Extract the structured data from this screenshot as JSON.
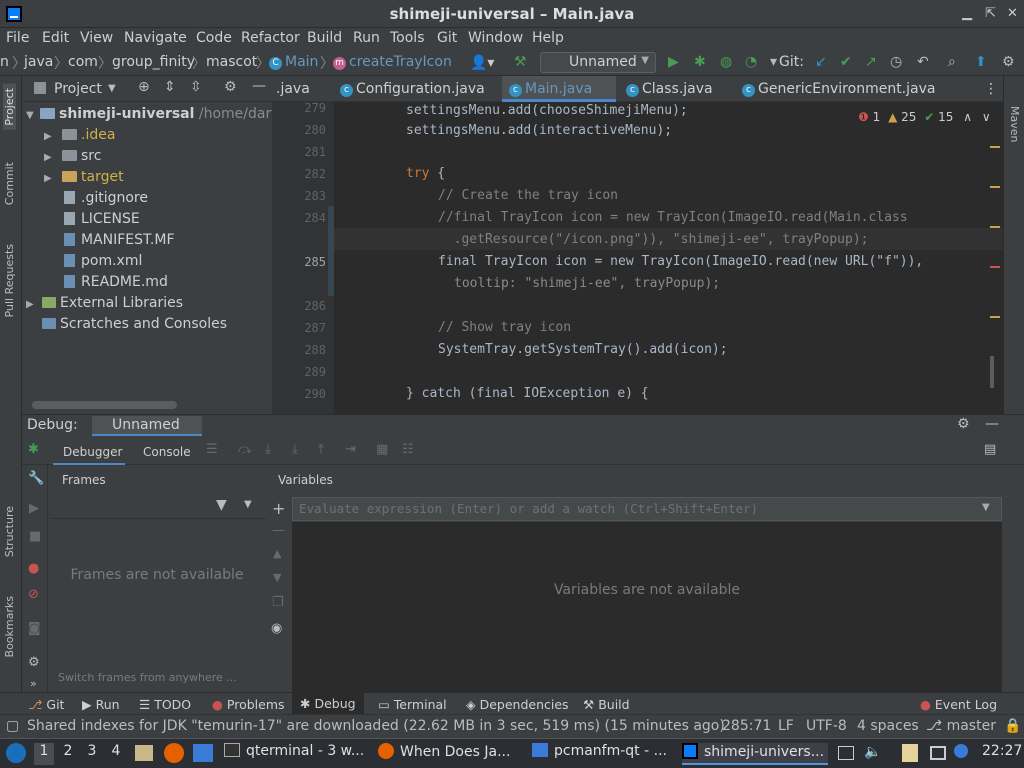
{
  "window": {
    "title": "shimeji-universal – Main.java"
  },
  "menu": [
    "File",
    "Edit",
    "View",
    "Navigate",
    "Code",
    "Refactor",
    "Build",
    "Run",
    "Tools",
    "Git",
    "Window",
    "Help"
  ],
  "nav": {
    "crumbs": [
      "n",
      "java",
      "com",
      "group_finity",
      "mascot",
      "Main",
      "createTrayIcon"
    ],
    "run_config": "Unnamed",
    "git_label": "Git:"
  },
  "project": {
    "title": "Project",
    "root": "shimeji-universal",
    "root_path": "/home/dartz",
    "items": [
      ".idea",
      "src",
      "target",
      ".gitignore",
      "LICENSE",
      "MANIFEST.MF",
      "pom.xml",
      "README.md",
      "External Libraries",
      "Scratches and Consoles"
    ]
  },
  "tabs": [
    ".java",
    "Configuration.java",
    "Main.java",
    "Class.java",
    "GenericEnvironment.java"
  ],
  "inspections": {
    "errors": "1",
    "warnings": "25",
    "ok": "15"
  },
  "code": {
    "lines": [
      {
        "n": "279",
        "text": "settingsMenu.add(chooseShimejiMenu);"
      },
      {
        "n": "280",
        "text": "settingsMenu.add(interactiveMenu);"
      },
      {
        "n": "281",
        "text": ""
      },
      {
        "n": "282",
        "kw": "try",
        "text": " {"
      },
      {
        "n": "283",
        "comment": "// Create the tray icon"
      },
      {
        "n": "284",
        "comment": "//final TrayIcon icon = new TrayIcon(ImageIO.read(Main.class"
      },
      {
        "n": "",
        "comment": "  .getResource(\"/icon.png\")), \"shimeji-ee\", trayPopup);"
      },
      {
        "n": "285",
        "text": "final TrayIcon icon = new TrayIcon(ImageIO.read(new URL(\"f\")),"
      },
      {
        "n": "",
        "text": "tooltip: \"shimeji-ee\", trayPopup);"
      },
      {
        "n": "286",
        "text": ""
      },
      {
        "n": "287",
        "comment": "// Show tray icon"
      },
      {
        "n": "288",
        "text": "SystemTray.getSystemTray().add(icon);"
      },
      {
        "n": "289",
        "text": ""
      },
      {
        "n": "290",
        "text": "} catch (final IOException e) {"
      }
    ]
  },
  "debug": {
    "label": "Debug:",
    "config": "Unnamed",
    "tab_debugger": "Debugger",
    "tab_console": "Console",
    "frames_title": "Frames",
    "frames_empty": "Frames are not available",
    "frames_hint": "Switch frames from anywhere ...",
    "vars_title": "Variables",
    "eval_placeholder": "Evaluate expression (Enter) or add a watch (Ctrl+Shift+Enter)",
    "vars_empty": "Variables are not available"
  },
  "side": {
    "left_top": [
      "Project",
      "Commit",
      "Pull Requests"
    ],
    "left_bottom": [
      "Structure",
      "Bookmarks"
    ],
    "right": [
      "Maven"
    ]
  },
  "tooltabs": [
    "Git",
    "Run",
    "TODO",
    "Problems",
    "Debug",
    "Terminal",
    "Dependencies",
    "Build",
    "Event Log"
  ],
  "status": {
    "message": "Shared indexes for JDK \"temurin-17\" are downloaded (22.62 MB in 3 sec, 519 ms) (15 minutes ago)",
    "position": "285:71",
    "line_sep": "LF",
    "encoding": "UTF-8",
    "indent": "4 spaces",
    "branch": "master"
  },
  "taskbar": {
    "desktops": [
      "1",
      "2",
      "3",
      "4"
    ],
    "tasks": [
      "qterminal - 3 w...",
      "When Does Ja...",
      "pcmanfm-qt - ...",
      "shimeji-univers..."
    ],
    "clock": "22:27"
  },
  "colors": {
    "accent": "#4a88c7",
    "error": "#c75450",
    "ok": "#499c54"
  }
}
